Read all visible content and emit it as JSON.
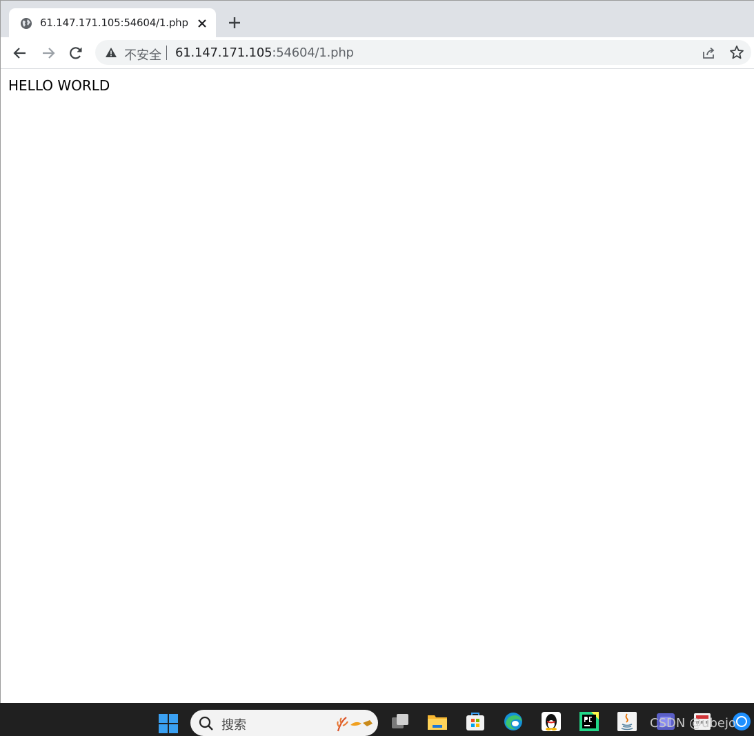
{
  "browser": {
    "tab": {
      "title": "61.147.171.105:54604/1.php",
      "favicon": "globe-icon"
    },
    "new_tab_icon": "plus-icon",
    "address_bar": {
      "security_label": "不安全",
      "url_host": "61.147.171.105",
      "url_rest": ":54604/1.php"
    }
  },
  "page": {
    "body_text": "HELLO WORLD"
  },
  "taskbar": {
    "search_placeholder": "搜索",
    "apps": [
      "start-icon",
      "task-view-icon",
      "file-explorer-icon",
      "store-icon",
      "edge-icon",
      "qq-icon",
      "pycharm-icon",
      "java-icon",
      "app-icon",
      "app-icon",
      "app-icon"
    ]
  },
  "watermark": "CSDN @ubejo",
  "colors": {
    "tabstrip": "#dee1e6",
    "omnibox": "#f1f3f4",
    "taskbar": "#202020"
  }
}
